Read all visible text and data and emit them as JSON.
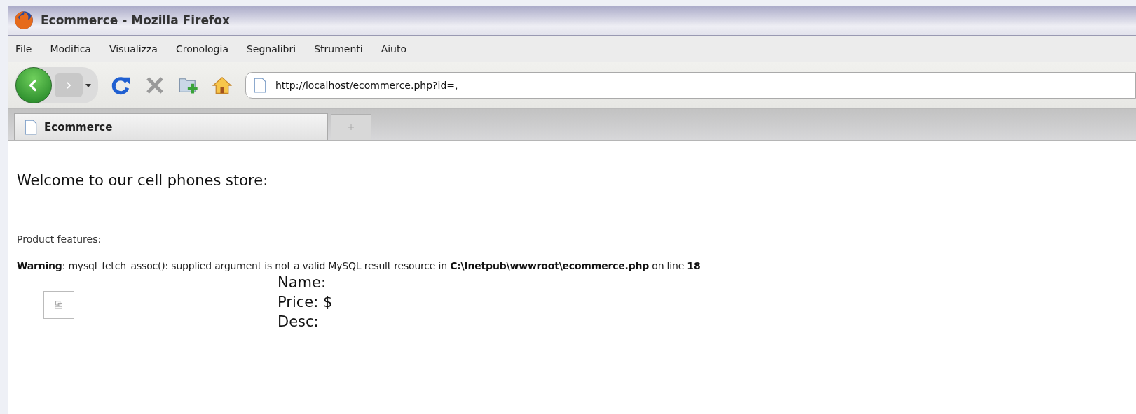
{
  "window": {
    "title": "Ecommerce - Mozilla Firefox"
  },
  "menu": [
    "File",
    "Modifica",
    "Visualizza",
    "Cronologia",
    "Segnalibri",
    "Strumenti",
    "Aiuto"
  ],
  "address_bar": {
    "value": "http://localhost/ecommerce.php?id=,"
  },
  "tabs": [
    {
      "label": "Ecommerce",
      "selected": true
    }
  ],
  "page": {
    "heading": "Welcome to our cell phones store:",
    "features_label": "Product features:",
    "warning": "**Warning**: mysql_fetch_assoc(): supplied argument is not a valid MySQL result resource in **C:\\Inetpub\\wwwroot\\ecommerce.php** on line **18**",
    "product_fields": [
      "Name:",
      "Price: $",
      "Desc:"
    ]
  }
}
